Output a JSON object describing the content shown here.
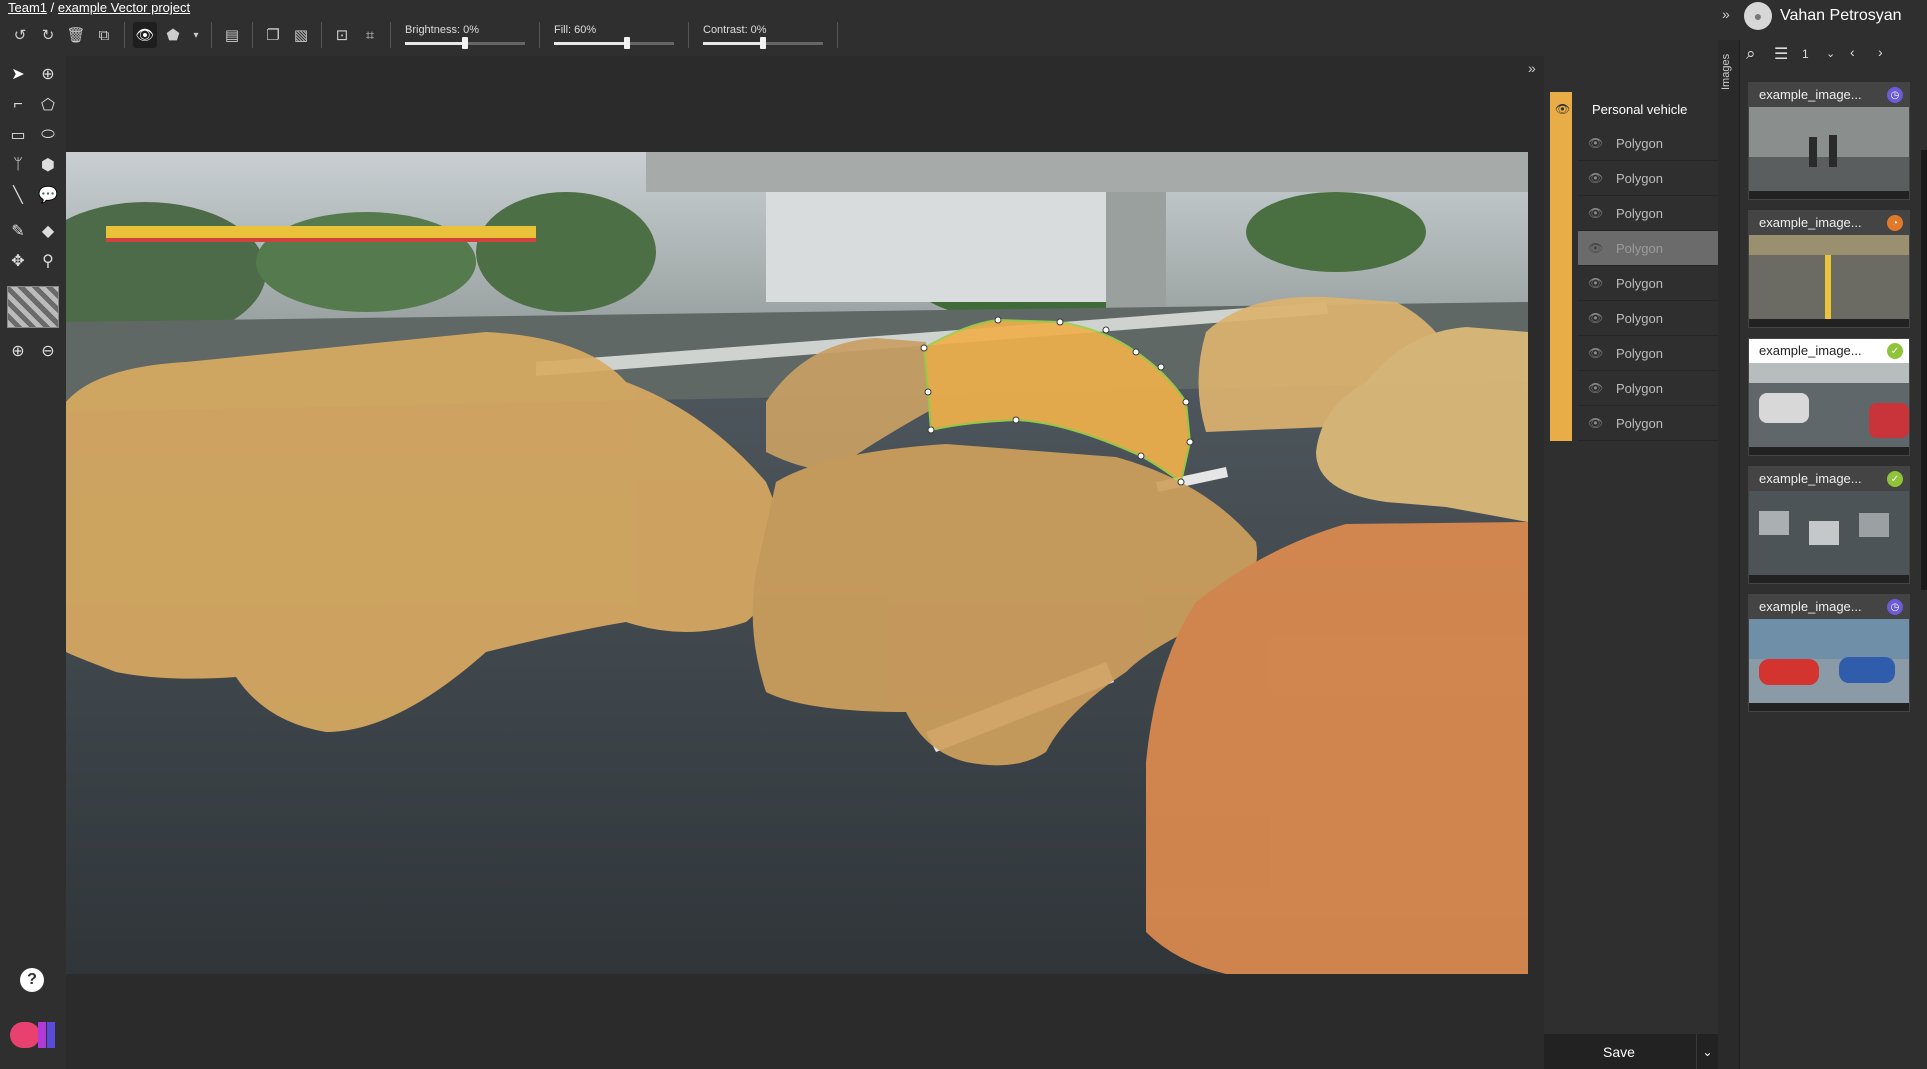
{
  "breadcrumb": {
    "team": "Team1",
    "separator": "/",
    "project": "example Vector project"
  },
  "toolbar": {
    "brightness_label": "Brightness: 0%",
    "brightness_value": 0,
    "fill_label": "Fill: 60%",
    "fill_value": 60,
    "contrast_label": "Contrast: 0%",
    "contrast_value": 0
  },
  "layers": {
    "class_name": "Personal vehicle",
    "class_color": "#e8ad47",
    "polygons": [
      {
        "label": "Polygon",
        "selected": false
      },
      {
        "label": "Polygon",
        "selected": false
      },
      {
        "label": "Polygon",
        "selected": false
      },
      {
        "label": "Polygon",
        "selected": true
      },
      {
        "label": "Polygon",
        "selected": false
      },
      {
        "label": "Polygon",
        "selected": false
      },
      {
        "label": "Polygon",
        "selected": false
      },
      {
        "label": "Polygon",
        "selected": false
      },
      {
        "label": "Polygon",
        "selected": false
      }
    ],
    "save_label": "Save"
  },
  "images_panel": {
    "tab_label": "Images",
    "user_name": "Vahan Petrosyan",
    "filter_value": "1",
    "items": [
      {
        "name": "example_image...",
        "status": "in-progress",
        "status_color": "#6b5bd6"
      },
      {
        "name": "example_image...",
        "status": "returned",
        "status_color": "#e07a2a"
      },
      {
        "name": "example_image...",
        "status": "completed",
        "status_color": "#8fc43a"
      },
      {
        "name": "example_image...",
        "status": "completed",
        "status_color": "#8fc43a"
      },
      {
        "name": "example_image...",
        "status": "in-progress",
        "status_color": "#6b5bd6"
      }
    ]
  },
  "help_label": "?",
  "colors": {
    "accent": "#e8ad47",
    "selection_outline": "#9ad04a"
  }
}
